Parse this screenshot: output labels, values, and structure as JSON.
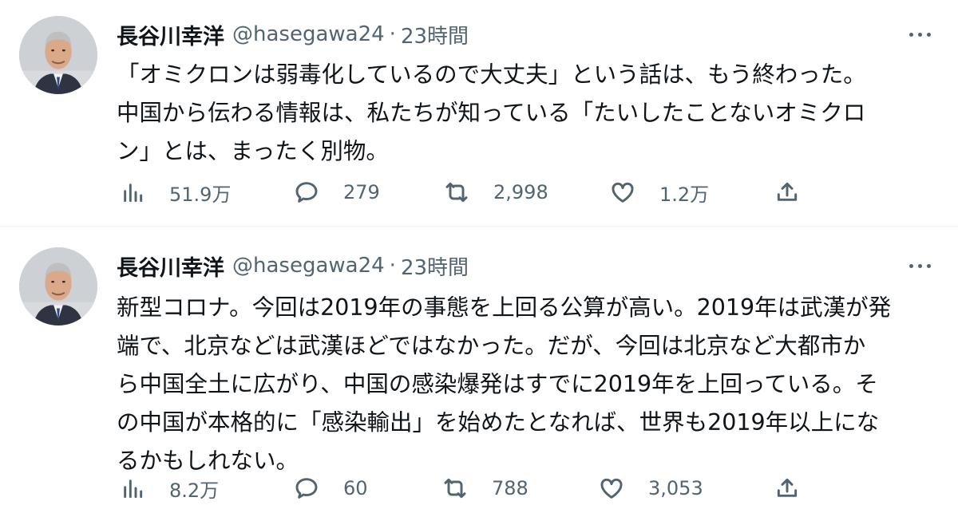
{
  "tweets": [
    {
      "author": {
        "name": "長谷川幸洋",
        "handle": "@hasegawa24"
      },
      "separator": "·",
      "time": "23時間",
      "lines": [
        "「オミクロンは弱毒化しているので大丈夫」という話は、もう終わった。",
        "中国から伝わる情報は、私たちが知っている「たいしたことないオミクロ",
        "ン」とは、まったく別物。"
      ],
      "stats": {
        "views": "51.9万",
        "replies": "279",
        "retweets": "2,998",
        "likes": "1.2万"
      }
    },
    {
      "author": {
        "name": "長谷川幸洋",
        "handle": "@hasegawa24"
      },
      "separator": "·",
      "time": "23時間",
      "lines": [
        "新型コロナ。今回は2019年の事態を上回る公算が高い。2019年は武漢が発",
        "端で、北京などは武漢ほどではなかった。だが、今回は北京など大都市か",
        "ら中国全土に広がり、中国の感染爆発はすでに2019年を上回っている。そ",
        "の中国が本格的に「感染輸出」を始めたとなれば、世界も2019年以上にな",
        "るかもしれない。"
      ],
      "stats": {
        "views": "8.2万",
        "replies": "60",
        "retweets": "788",
        "likes": "3,053"
      }
    }
  ],
  "icons": {
    "views": "bar-chart-icon",
    "reply": "speech-bubble-icon",
    "retweet": "retweet-arrows-icon",
    "like": "heart-icon",
    "share": "share-upload-icon",
    "more": "more-horizontal-icon"
  },
  "colors": {
    "text": "#0f1419",
    "secondary": "#536471",
    "divider": "#eff3f4"
  }
}
